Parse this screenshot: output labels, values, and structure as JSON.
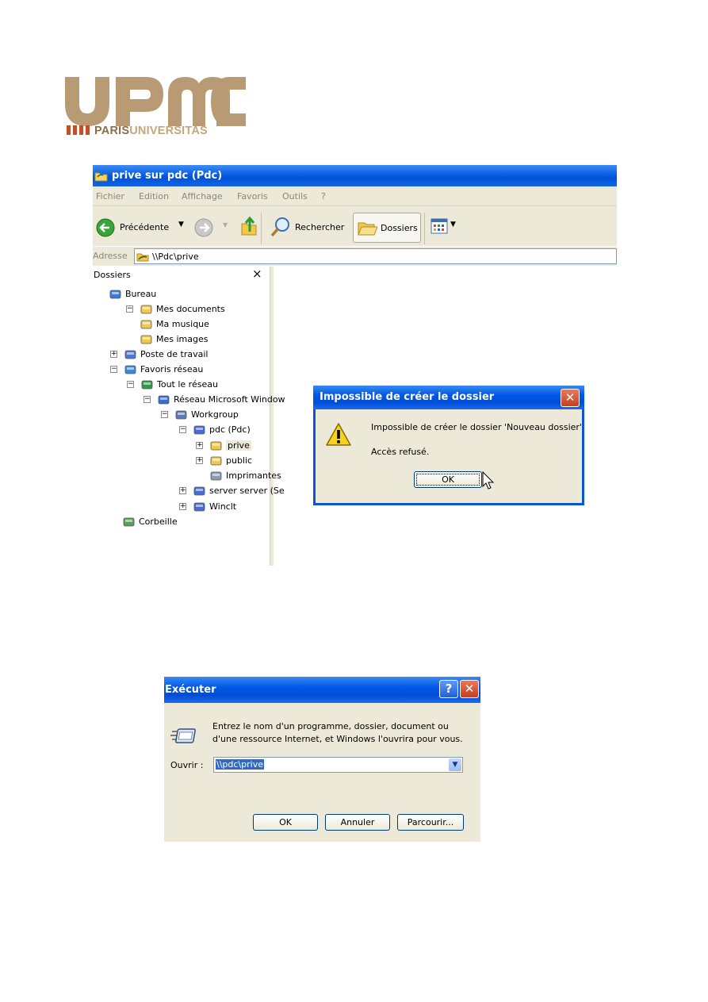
{
  "logo": {
    "wordmark": "UPMC",
    "tagline_a": "PARIS",
    "tagline_b": "UNIVERSITAS",
    "color_dark": "#8a6e4b",
    "color_light": "#c4a57c",
    "color_accent": "#c0502a"
  },
  "explorer": {
    "title": "prive sur pdc (Pdc)",
    "menu": [
      "Fichier",
      "Edition",
      "Affichage",
      "Favoris",
      "Outils",
      "?"
    ],
    "toolbar": {
      "back": "Précédente",
      "search": "Rechercher",
      "folders": "Dossiers"
    },
    "address": {
      "label": "Adresse",
      "value": "\\\\Pdc\\prive"
    },
    "folders_pane": {
      "title": "Dossiers",
      "close": "×"
    },
    "tree": [
      {
        "label": "Bureau",
        "icon": "desktop-icon"
      },
      {
        "label": "Mes documents",
        "icon": "my-documents-icon"
      },
      {
        "label": "Ma musique",
        "icon": "music-folder-icon"
      },
      {
        "label": "Mes images",
        "icon": "pictures-folder-icon"
      },
      {
        "label": "Poste de travail",
        "icon": "my-computer-icon"
      },
      {
        "label": "Favoris réseau",
        "icon": "network-places-icon"
      },
      {
        "label": "Tout le réseau",
        "icon": "entire-network-icon"
      },
      {
        "label": "Réseau Microsoft Window",
        "icon": "microsoft-network-icon"
      },
      {
        "label": "Workgroup",
        "icon": "workgroup-icon"
      },
      {
        "label": "pdc (Pdc)",
        "icon": "computer-icon"
      },
      {
        "label": "prive",
        "icon": "network-share-icon"
      },
      {
        "label": "public",
        "icon": "network-share-icon"
      },
      {
        "label": "Imprimantes",
        "icon": "printers-icon"
      },
      {
        "label": "server server (Se",
        "icon": "computer-icon"
      },
      {
        "label": "Winclt",
        "icon": "computer-icon"
      },
      {
        "label": "Corbeille",
        "icon": "recycle-bin-icon"
      }
    ]
  },
  "error_dialog": {
    "title": "Impossible de créer le dossier",
    "message": "Impossible de créer le dossier 'Nouveau dossier'",
    "detail": "Accès refusé.",
    "ok": "OK"
  },
  "run_dialog": {
    "title": "Exécuter",
    "help": "?",
    "description_line1": "Entrez le nom d'un programme, dossier, document ou",
    "description_line2": "d'une ressource Internet, et Windows l'ouvrira pour vous.",
    "open_label": "Ouvrir :",
    "open_value": "\\\\pdc\\prive",
    "ok": "OK",
    "cancel": "Annuler",
    "browse": "Parcourir..."
  }
}
